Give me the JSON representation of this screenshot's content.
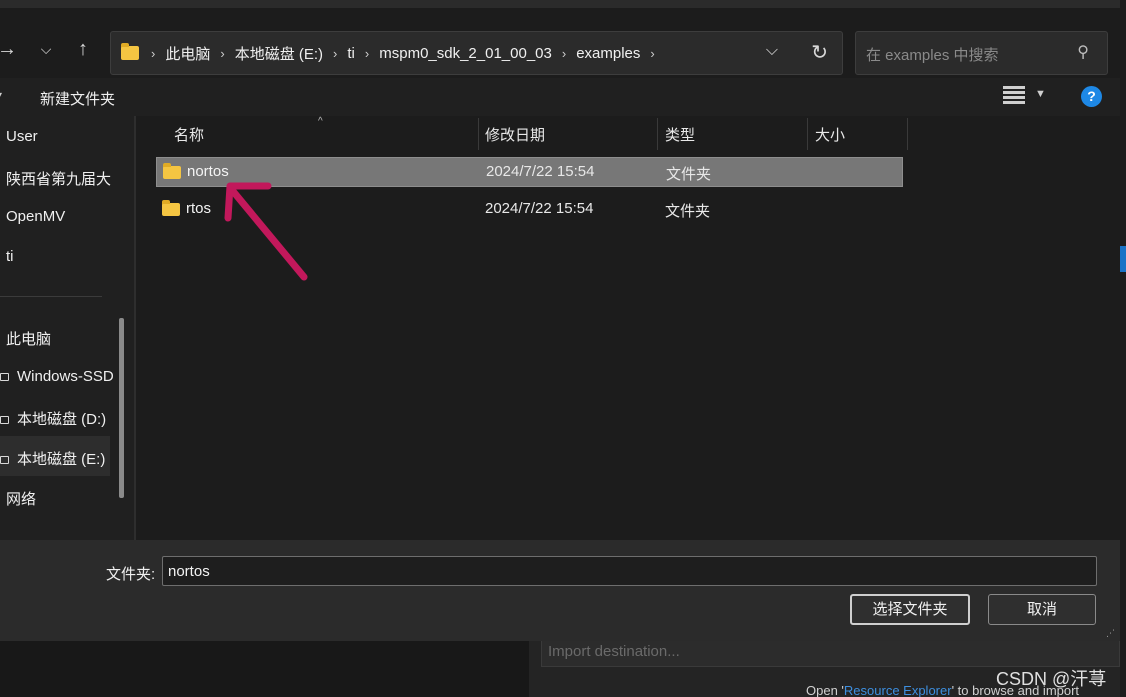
{
  "nav": {
    "forward_icon": "arrow-right-icon",
    "recent_icon": "chevron-down-icon",
    "up_icon": "arrow-up-icon"
  },
  "address": {
    "crumbs": [
      "此电脑",
      "本地磁盘 (E:)",
      "ti",
      "mspm0_sdk_2_01_00_03",
      "examples"
    ]
  },
  "search": {
    "placeholder": "在 examples 中搜索"
  },
  "toolbar": {
    "new_folder": "新建文件夹",
    "help": "?"
  },
  "sidebar": {
    "quick": [
      "User",
      "陕西省第九届大",
      "OpenMV",
      "ti"
    ],
    "this_pc": "此电脑",
    "drives": [
      "Windows-SSD",
      "本地磁盘 (D:)",
      "本地磁盘 (E:)"
    ],
    "network": "网络"
  },
  "columns": {
    "name": "名称",
    "modified": "修改日期",
    "type": "类型",
    "size": "大小"
  },
  "files": [
    {
      "name": "nortos",
      "modified": "2024/7/22 15:54",
      "type": "文件夹",
      "selected": true
    },
    {
      "name": "rtos",
      "modified": "2024/7/22 15:54",
      "type": "文件夹",
      "selected": false
    }
  ],
  "footer": {
    "folder_label": "文件夹:",
    "folder_value": "nortos",
    "select_button": "选择文件夹",
    "cancel_button": "取消"
  },
  "background": {
    "import_placeholder": "Import destination...",
    "open_text": "Open '",
    "link_text": "Resource Explorer",
    "rest_text": "' to browse and import"
  },
  "watermark": "CSDN @汗荨",
  "colors": {
    "accent": "#1e88e5",
    "arrow": "#c2185b",
    "folder": "#f4c542"
  }
}
